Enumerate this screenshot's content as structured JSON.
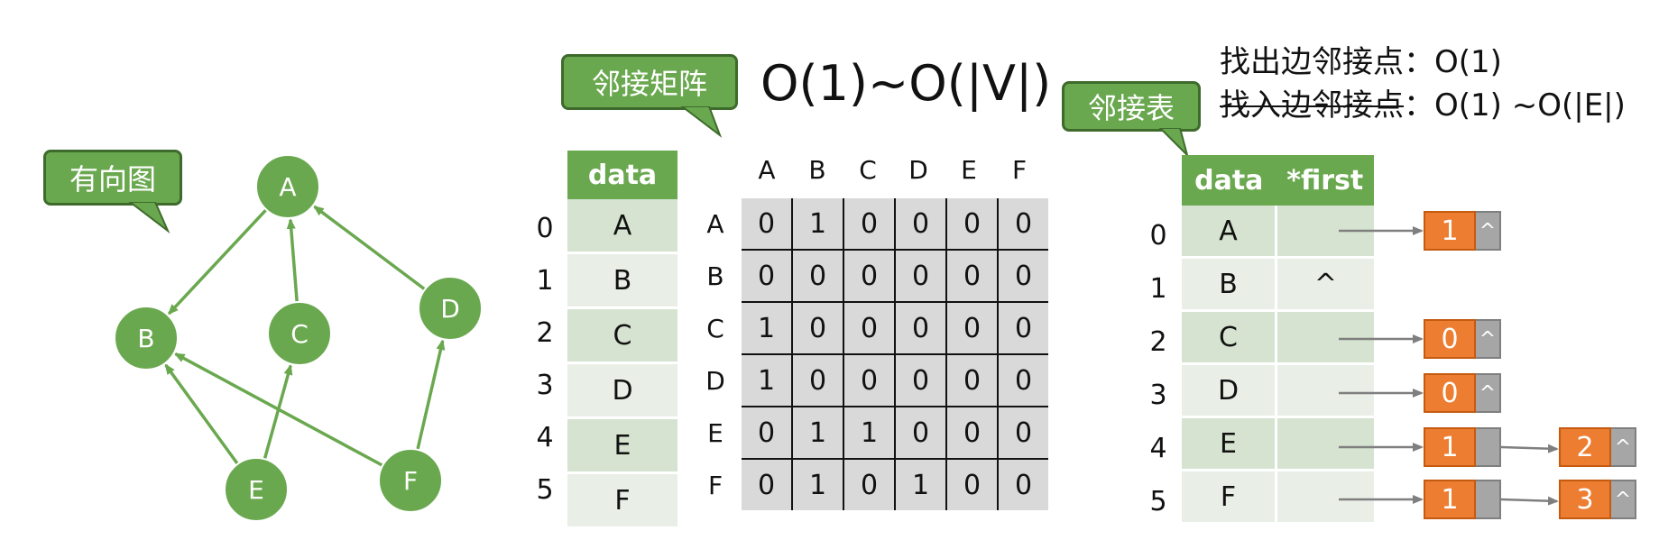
{
  "callouts": {
    "digraph": "有向图",
    "matrix": "邻接矩阵",
    "list": "邻接表"
  },
  "complexity": {
    "matrix": "O(1)~O(|V|)",
    "out_edges": "找出边邻接点：O(1)",
    "in_edges_strike": "找入边邻接点",
    "in_edges_rest": "：O(1) ~O(|E|)"
  },
  "graph": {
    "vertices": [
      "A",
      "B",
      "C",
      "D",
      "E",
      "F"
    ],
    "edges": [
      [
        "A",
        "B"
      ],
      [
        "C",
        "A"
      ],
      [
        "D",
        "A"
      ],
      [
        "E",
        "B"
      ],
      [
        "E",
        "C"
      ],
      [
        "F",
        "B"
      ],
      [
        "F",
        "D"
      ]
    ]
  },
  "vertex_table": {
    "header": "data",
    "indices": [
      "0",
      "1",
      "2",
      "3",
      "4",
      "5"
    ],
    "values": [
      "A",
      "B",
      "C",
      "D",
      "E",
      "F"
    ]
  },
  "matrix": {
    "col_headers": [
      "A",
      "B",
      "C",
      "D",
      "E",
      "F"
    ],
    "row_headers": [
      "A",
      "B",
      "C",
      "D",
      "E",
      "F"
    ],
    "rows": [
      [
        "0",
        "1",
        "0",
        "0",
        "0",
        "0"
      ],
      [
        "0",
        "0",
        "0",
        "0",
        "0",
        "0"
      ],
      [
        "1",
        "0",
        "0",
        "0",
        "0",
        "0"
      ],
      [
        "1",
        "0",
        "0",
        "0",
        "0",
        "0"
      ],
      [
        "0",
        "1",
        "1",
        "0",
        "0",
        "0"
      ],
      [
        "0",
        "1",
        "0",
        "1",
        "0",
        "0"
      ]
    ]
  },
  "adj_list": {
    "headers": [
      "data",
      "*first"
    ],
    "indices": [
      "0",
      "1",
      "2",
      "3",
      "4",
      "5"
    ],
    "data": [
      "A",
      "B",
      "C",
      "D",
      "E",
      "F"
    ],
    "first": [
      "",
      "^",
      "",
      "",
      "",
      ""
    ],
    "null_symbol": "^",
    "edge_nodes": [
      [
        "1"
      ],
      [],
      [
        "0"
      ],
      [
        "0"
      ],
      [
        "1",
        "2"
      ],
      [
        "1",
        "3"
      ]
    ]
  },
  "colors": {
    "green": "#6aa84f",
    "orange": "#ed7d31",
    "gray": "#a6a6a6",
    "matrix_bg": "#d9d9d9"
  }
}
